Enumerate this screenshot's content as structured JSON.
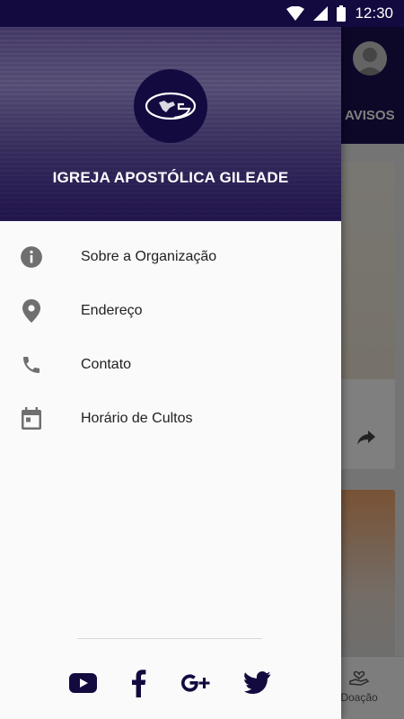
{
  "status_bar": {
    "time": "12:30"
  },
  "background_app": {
    "tab_label": "AVISOS",
    "bottom_nav_label": "Doação"
  },
  "drawer": {
    "header": {
      "title": "IGREJA APOSTÓLICA GILEADE"
    },
    "menu": [
      {
        "label": "Sobre a Organização",
        "icon": "info-icon"
      },
      {
        "label": "Endereço",
        "icon": "location-pin-icon"
      },
      {
        "label": "Contato",
        "icon": "phone-icon"
      },
      {
        "label": "Horário de Cultos",
        "icon": "calendar-icon"
      }
    ],
    "social": [
      {
        "icon": "youtube-icon"
      },
      {
        "icon": "facebook-icon"
      },
      {
        "icon": "google-plus-icon"
      },
      {
        "icon": "twitter-icon"
      }
    ]
  },
  "colors": {
    "brand": "#130a40",
    "icon_gray": "#6f6f6f",
    "text": "#212121"
  }
}
